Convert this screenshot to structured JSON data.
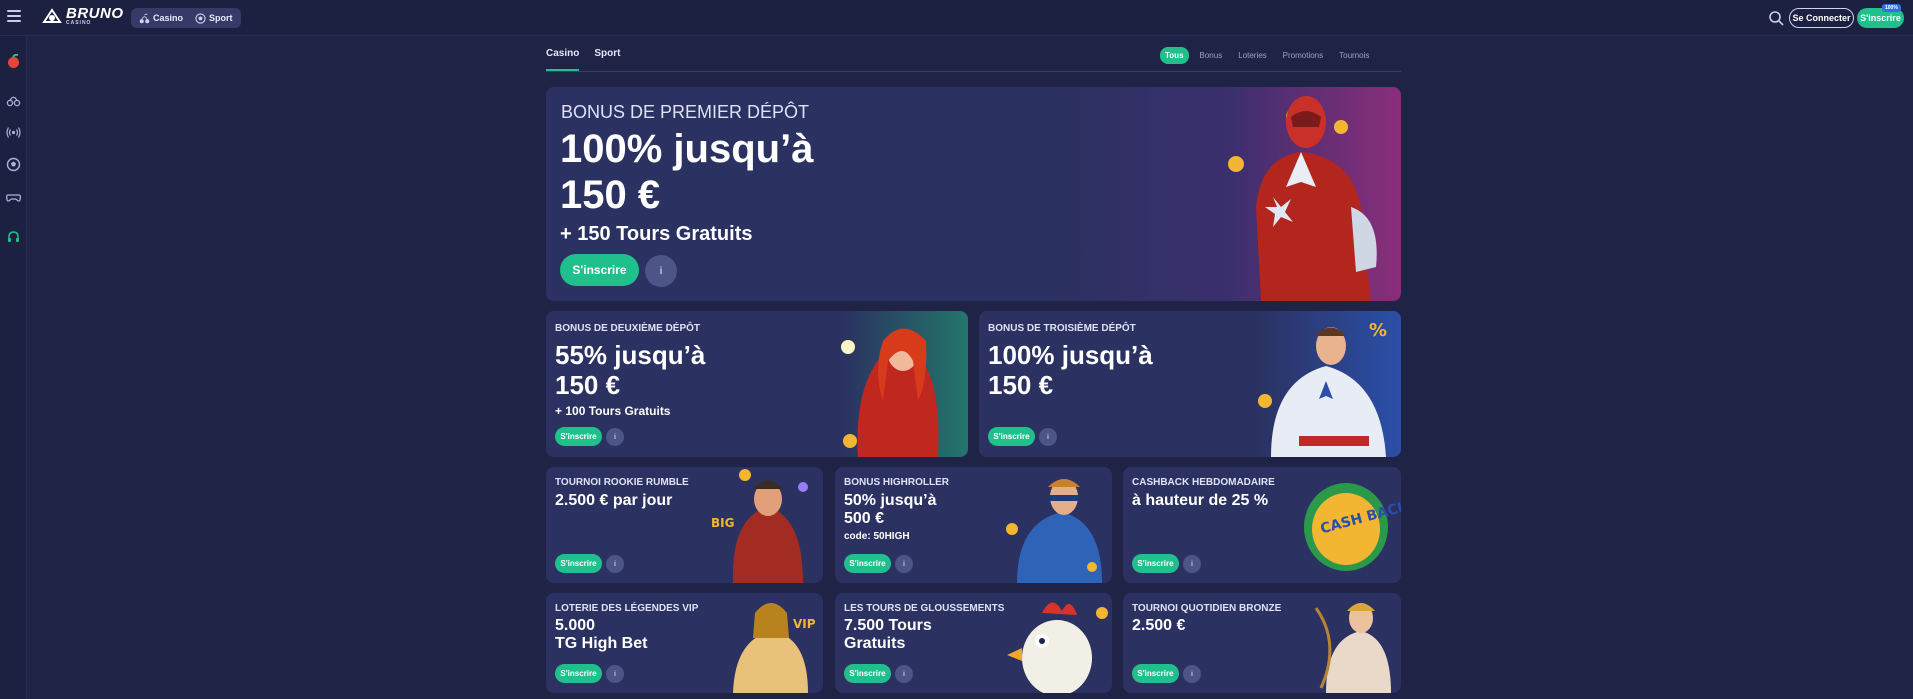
{
  "brand": {
    "name": "BRUNO",
    "sub": "CASINO"
  },
  "top_nav": {
    "casino": "Casino",
    "sport": "Sport"
  },
  "header": {
    "login": "Se Connecter",
    "register": "S'inscrire",
    "register_badge": "100%"
  },
  "tabs": {
    "casino": "Casino",
    "sport": "Sport"
  },
  "filters": [
    "Tous",
    "Bonus",
    "Loteries",
    "Promotions",
    "Tournois"
  ],
  "icons": [
    "menu-icon",
    "search-icon",
    "fruit-icon",
    "cherries-icon",
    "live-icon",
    "soccer-ball-icon",
    "gamepad-icon",
    "headset-icon",
    "info-icon"
  ],
  "colors": {
    "accent": "#1fc08c",
    "background": "#1f2447",
    "card": "#2b3160"
  },
  "hero": {
    "kicker": "BONUS DE PREMIER DÉPÔT",
    "line1": "100% jusqu’à",
    "line2": "150 €",
    "sub": "+ 150 Tours Gratuits",
    "cta": "S'inscrire"
  },
  "cards": [
    {
      "kicker": "BONUS DE DEUXIÈME DÉPÔT",
      "line1": "55% jusqu’à",
      "line2": "150 €",
      "sub": "+ 100 Tours Gratuits",
      "cta": "S'inscrire"
    },
    {
      "kicker": "BONUS DE TROISIÈME DÉPÔT",
      "line1": "100% jusqu’à",
      "line2": "150 €",
      "cta": "S'inscrire"
    },
    {
      "kicker": "TOURNOI ROOKIE RUMBLE",
      "line1": "2.500 € par jour",
      "cta": "S'inscrire"
    },
    {
      "kicker": "BONUS HIGHROLLER",
      "line1": "50% jusqu’à",
      "line2": "500 €",
      "sub": "code: 50HIGH",
      "cta": "S'inscrire"
    },
    {
      "kicker": "CASHBACK HEBDOMADAIRE",
      "line1": "à hauteur de 25 %",
      "cta": "S'inscrire"
    },
    {
      "kicker": "LOTERIE DES LÉGENDES VIP",
      "line1": "5.000",
      "line2": "TG High Bet",
      "cta": "S'inscrire"
    },
    {
      "kicker": "LES TOURS DE GLOUSSEMENTS",
      "line1": "7.500 Tours",
      "line2": "Gratuits",
      "cta": "S'inscrire"
    },
    {
      "kicker": "TOURNOI QUOTIDIEN BRONZE",
      "line1": "2.500 €",
      "cta": "S'inscrire"
    }
  ],
  "art_labels": {
    "cashback": "CASH BACK",
    "vip": "VIP",
    "percent": "%",
    "big": "BIG"
  }
}
